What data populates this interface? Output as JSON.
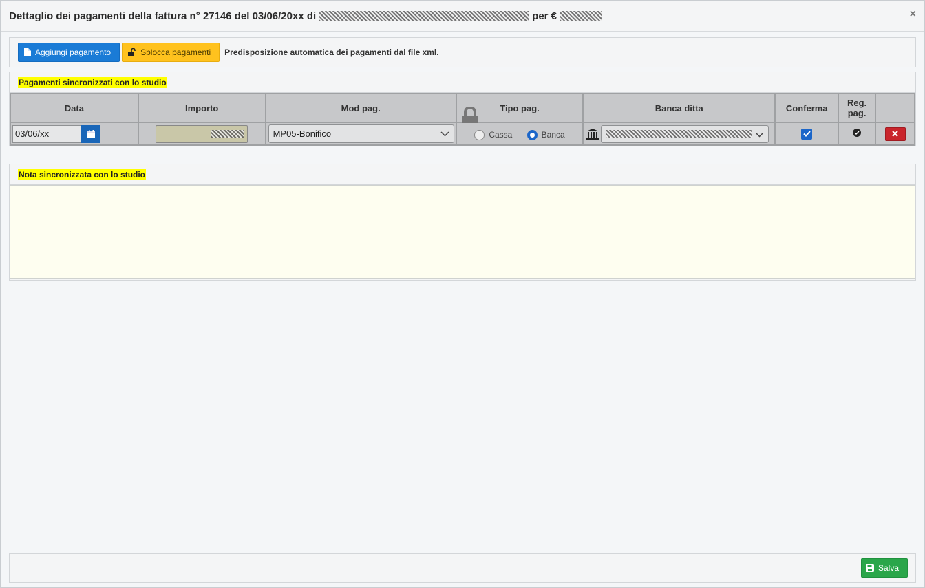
{
  "header": {
    "title_prefix": "Dettaglio dei pagamenti della fattura n° 27146 del 03/06/20xx di",
    "title_per": "per €",
    "close_glyph": "×"
  },
  "toolbar": {
    "add_label": "Aggiungi pagamento",
    "unlock_label": "Sblocca pagamenti",
    "note": "Predisposizione automatica dei pagamenti dal file xml."
  },
  "payments": {
    "section_title": "Pagamenti sincronizzati con lo studio",
    "columns": [
      "Data",
      "Importo",
      "Mod pag.",
      "Tipo pag.",
      "Banca ditta",
      "Conferma",
      "Reg. pag.",
      ""
    ],
    "rows": [
      {
        "data": "03/06/xx",
        "mod_pag": "MP05-Bonifico",
        "tipo_cassa": "Cassa",
        "tipo_banca": "Banca",
        "tipo_selected": "Banca",
        "conferma": true,
        "reg_pag": true
      }
    ]
  },
  "note_section": {
    "title": "Nota sincronizzata con lo studio",
    "value": ""
  },
  "footer": {
    "save_label": "Salva"
  },
  "colors": {
    "primary": "#1a7bd6",
    "warning": "#ffc21e",
    "success": "#2aa64a",
    "danger": "#c9252c",
    "highlight": "#ffff00"
  }
}
